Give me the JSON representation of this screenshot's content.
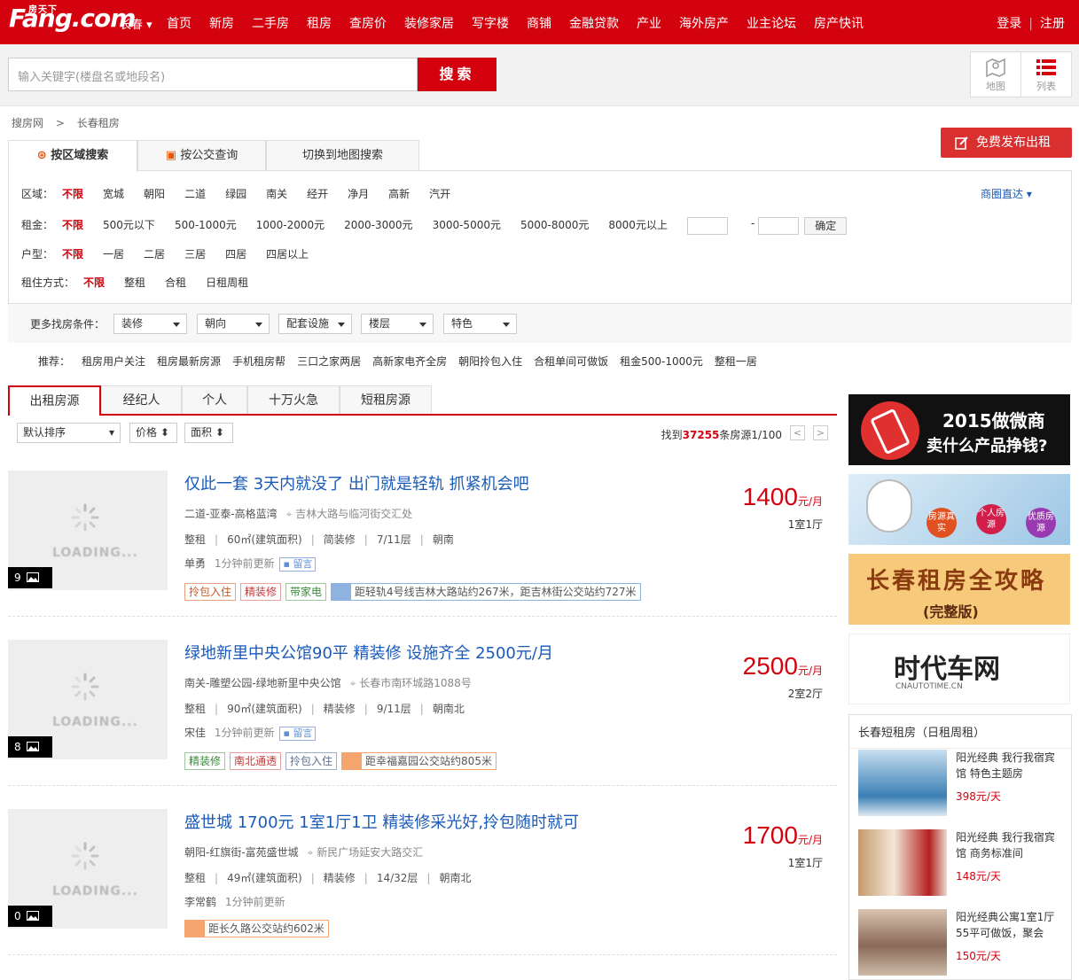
{
  "header": {
    "logo_text": "Fang.com",
    "logo_cn": "房天下",
    "city": "长春",
    "nav": [
      "首页",
      "新房",
      "二手房",
      "租房",
      "查房价",
      "装修家居",
      "写字楼",
      "商铺",
      "金融贷款",
      "产业",
      "海外房产",
      "业主论坛",
      "房产快讯"
    ],
    "login": "登录",
    "register": "注册"
  },
  "search": {
    "placeholder": "输入关键字(楼盘名或地段名)",
    "button": "搜索",
    "view_map": "地图",
    "view_list": "列表"
  },
  "breadcrumb": [
    "搜房网",
    ">",
    "长春租房"
  ],
  "publish_button": "免费发布出租",
  "filter_tabs": [
    "按区域搜索",
    "按公交查询",
    "切换到地图搜索"
  ],
  "filters": {
    "area_label": "区域：",
    "area": [
      "不限",
      "宽城",
      "朝阳",
      "二道",
      "绿园",
      "南关",
      "经开",
      "净月",
      "高新",
      "汽开"
    ],
    "area_link": "商圈直达",
    "rent_label": "租金：",
    "rent": [
      "不限",
      "500元以下",
      "500-1000元",
      "1000-2000元",
      "2000-3000元",
      "3000-5000元",
      "5000-8000元",
      "8000元以上"
    ],
    "rent_confirm": "确定",
    "layout_label": "户型：",
    "layout": [
      "不限",
      "一居",
      "二居",
      "三居",
      "四居",
      "四居以上"
    ],
    "mode_label": "租住方式：",
    "mode": [
      "不限",
      "整租",
      "合租",
      "日租周租"
    ],
    "more_label": "更多找房条件：",
    "more": [
      "装修",
      "朝向",
      "配套设施",
      "楼层",
      "特色"
    ]
  },
  "recommend": {
    "label": "推荐：",
    "items": [
      "租房用户关注",
      "租房最新房源",
      "手机租房帮",
      "三口之家两居",
      "高新家电齐全房",
      "朝阳拎包入住",
      "合租单间可做饭",
      "租金500-1000元",
      "整租一居"
    ]
  },
  "list_tabs": [
    "出租房源",
    "经纪人",
    "个人",
    "十万火急",
    "短租房源"
  ],
  "sort": {
    "default": "默认排序",
    "price": "价格",
    "area": "面积",
    "found_prefix": "找到",
    "found_count": "37255",
    "found_suffix": "条房源1/100",
    "prev": "<",
    "next": ">"
  },
  "listings": [
    {
      "title": "仅此一套 3天内就没了 出门就是轻轨 抓紧机会吧",
      "community": "二道-亚泰-高格蓝湾",
      "address": "吉林大路与临河街交汇处",
      "rent_type": "整租",
      "area": "60㎡(建筑面积)",
      "decoration": "简装修",
      "floor": "7/11层",
      "orientation": "朝南",
      "agent": "单勇",
      "updated": "1分钟前更新",
      "message": "留言",
      "tags": [
        "拎包入住",
        "精装修",
        "带家电"
      ],
      "transport": "距轻轨4号线吉林大路站约267米，距吉林街公交站约727米",
      "transport_kind": "rail",
      "price": "1400",
      "unit": "元/月",
      "rooms": "1室1厅",
      "pics": "9",
      "loading": "LOADING..."
    },
    {
      "title": "绿地新里中央公馆90平 精装修 设施齐全 2500元/月",
      "community": "南关-雕塑公园-绿地新里中央公馆",
      "address": "长春市南环城路1088号",
      "rent_type": "整租",
      "area": "90㎡(建筑面积)",
      "decoration": "精装修",
      "floor": "9/11层",
      "orientation": "朝南北",
      "agent": "宋佳",
      "updated": "1分钟前更新",
      "message": "留言",
      "tags": [
        "精装修",
        "南北通透",
        "拎包入住"
      ],
      "transport": "距幸福嘉园公交站约805米",
      "transport_kind": "bus",
      "price": "2500",
      "unit": "元/月",
      "rooms": "2室2厅",
      "pics": "8",
      "loading": "LOADING..."
    },
    {
      "title": "盛世城 1700元 1室1厅1卫 精装修采光好,拎包随时就可",
      "community": "朝阳-红旗街-富苑盛世城",
      "address": "新民广场延安大路交汇",
      "rent_type": "整租",
      "area": "49㎡(建筑面积)",
      "decoration": "精装修",
      "floor": "14/32层",
      "orientation": "朝南北",
      "agent": "李常鹤",
      "updated": "1分钟前更新",
      "tags": [],
      "transport": "距长久路公交站约602米",
      "transport_kind": "bus",
      "price": "1700",
      "unit": "元/月",
      "rooms": "1室1厅",
      "pics": "0",
      "loading": "LOADING..."
    }
  ],
  "ads": {
    "ad1_line1": "2015做微商",
    "ad1_line2": "卖什么产品挣钱?",
    "ad2_b1": "房源真实",
    "ad2_b2": "个人房源",
    "ad2_b3": "优质房源",
    "ad3_title": "长春租房全攻略",
    "ad3_sub": "(完整版)",
    "ad4_title": "时代车网",
    "ad4_sub": "CNAUTOTIME.CN"
  },
  "short_rent": {
    "title": "长春短租房（日租周租）",
    "items": [
      {
        "name": "阳光经典 我行我宿宾馆 特色主题房",
        "price": "398元/天"
      },
      {
        "name": "阳光经典 我行我宿宾馆 商务标准间",
        "price": "148元/天"
      },
      {
        "name": "阳光经典公寓1室1厅55平可做饭，聚会",
        "price": "150元/天"
      }
    ]
  },
  "colors": {
    "brand": "#d4020f",
    "link": "#1a5ab8"
  }
}
